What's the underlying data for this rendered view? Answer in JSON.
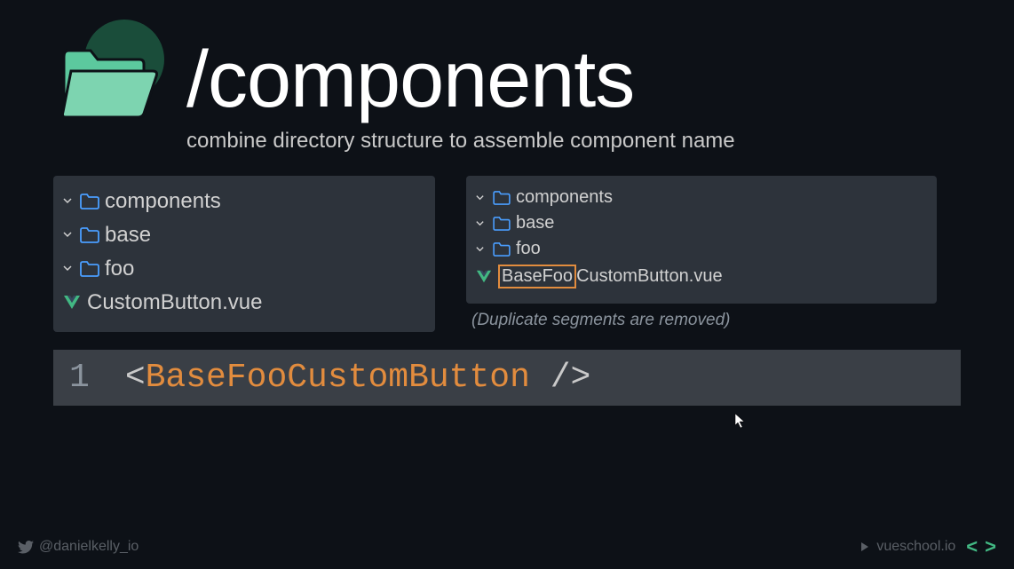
{
  "header": {
    "title": "/components",
    "subtitle": "combine directory structure to assemble component name"
  },
  "left_tree": {
    "items": [
      {
        "label": "components"
      },
      {
        "label": "base"
      },
      {
        "label": "foo"
      },
      {
        "label": "CustomButton.vue"
      }
    ]
  },
  "right_tree": {
    "items": [
      {
        "label": "components"
      },
      {
        "label": "base"
      },
      {
        "label": "foo"
      },
      {
        "highlight": "BaseFoo",
        "rest": "CustomButton.vue"
      }
    ],
    "note": "(Duplicate segments are removed)"
  },
  "code": {
    "line_number": "1",
    "open": "<",
    "tag": "BaseFooCustomButton",
    "close": " />"
  },
  "footer": {
    "twitter": "@danielkelly_io",
    "site": "vueschool.io"
  }
}
